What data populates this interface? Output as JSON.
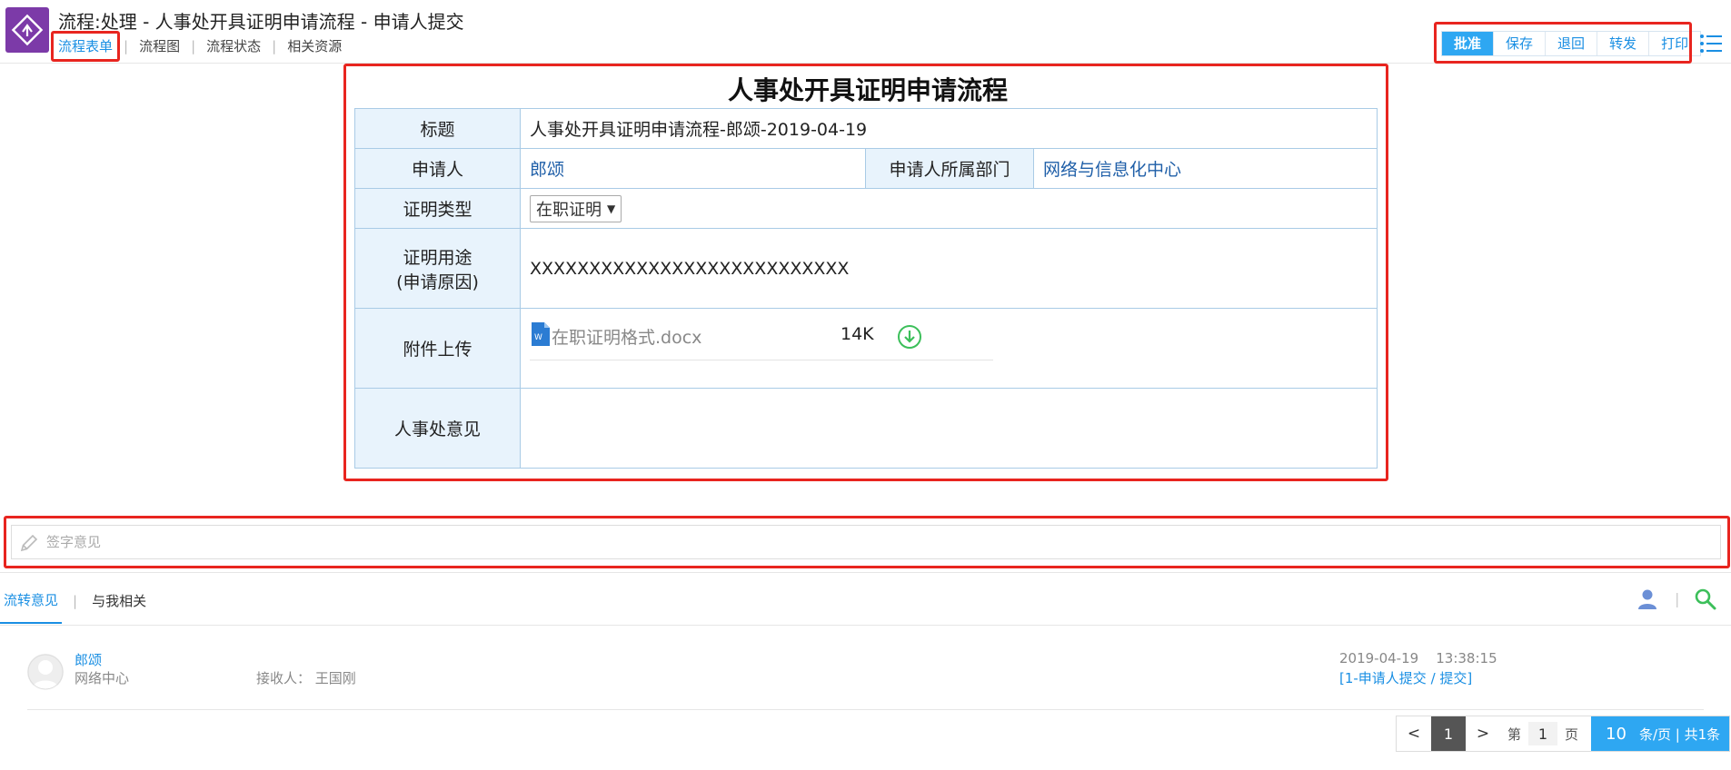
{
  "header": {
    "title": "流程:处理 - 人事处开具证明申请流程 - 申请人提交",
    "nav": [
      "流程表单",
      "流程图",
      "流程状态",
      "相关资源"
    ],
    "actions": [
      "批准",
      "保存",
      "退回",
      "转发",
      "打印"
    ]
  },
  "form": {
    "title": "人事处开具证明申请流程",
    "fields": {
      "title_label": "标题",
      "title_value": "人事处开具证明申请流程-郎颂-2019-04-19",
      "applicant_label": "申请人",
      "applicant_value": "郎颂",
      "dept_label": "申请人所属部门",
      "dept_value": "网络与信息化中心",
      "type_label": "证明类型",
      "type_value": "在职证明",
      "purpose_label_line1": "证明用途",
      "purpose_label_line2": "(申请原因)",
      "purpose_value": "XXXXXXXXXXXXXXXXXXXXXXXXXXX",
      "attach_label": "附件上传",
      "attach_name": "在职证明格式.docx",
      "attach_size": "14K",
      "opinion_label": "人事处意见"
    }
  },
  "sign": {
    "placeholder": "签字意见"
  },
  "tabs": [
    "流转意见",
    "与我相关"
  ],
  "record": {
    "name": "郎颂",
    "dept": "网络中心",
    "receiver": "接收人： 王国刚",
    "time": "2019-04-19    13:38:15",
    "step": "[1-申请人提交 / 提交]"
  },
  "pager": {
    "prev": "<",
    "current": "1",
    "next": ">",
    "page_prefix": "第",
    "page_input": "1",
    "page_suffix": "页",
    "page_size": "10",
    "size_suffix": "条/页 | 共1条"
  },
  "colors": {
    "accent": "#1a8fe3",
    "primary_button": "#2ea7f2",
    "highlight_box": "#e8251f",
    "app_icon": "#7c3aa8"
  }
}
